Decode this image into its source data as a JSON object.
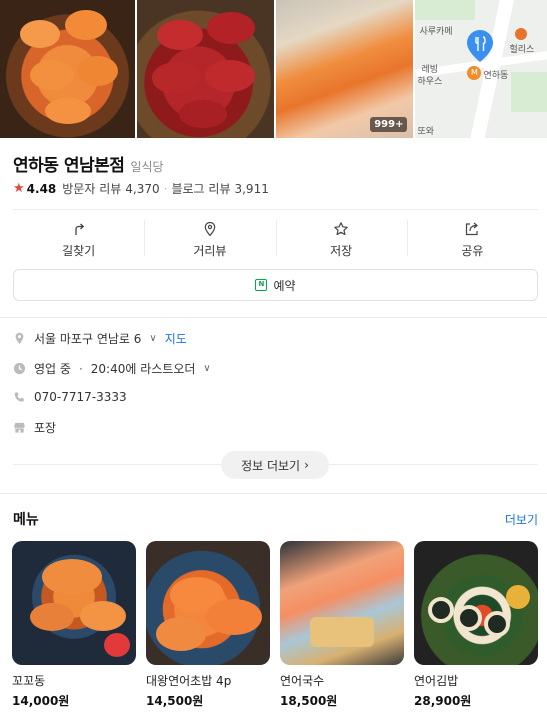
{
  "photos": {
    "count_badge": "999+"
  },
  "map": {
    "labels": [
      "사루카메",
      "헐리스",
      "연하동",
      "레빙",
      "하우스",
      "또와"
    ],
    "pin_color": "#3b8ff0"
  },
  "place": {
    "name": "연하동 연남본점",
    "category": "일식당",
    "rating": "4.48",
    "visitor_reviews_label": "방문자 리뷰",
    "visitor_reviews_count": "4,370",
    "blog_reviews_label": "블로그 리뷰",
    "blog_reviews_count": "3,911",
    "star_color": "#e8453c"
  },
  "actions": [
    {
      "label": "길찾기",
      "icon": "directions-icon"
    },
    {
      "label": "거리뷰",
      "icon": "location-pin-icon"
    },
    {
      "label": "저장",
      "icon": "star-outline-icon"
    },
    {
      "label": "공유",
      "icon": "share-icon"
    }
  ],
  "reserve": {
    "label": "예약",
    "icon_text": "N"
  },
  "info": {
    "address": "서울 마포구 연남로 6",
    "map_link": "지도",
    "status": "영업 중",
    "hours": "20:40에 라스트오더",
    "phone": "070-7717-3333",
    "service": "포장"
  },
  "more_info_label": "정보 더보기",
  "menu": {
    "title": "메뉴",
    "more_label": "더보기",
    "items": [
      {
        "name": "꼬꼬동",
        "price": "14,000원"
      },
      {
        "name": "대왕연어초밥 4p",
        "price": "14,500원"
      },
      {
        "name": "연어국수",
        "price": "18,500원"
      },
      {
        "name": "연어김밥",
        "price": "28,900원"
      }
    ]
  }
}
